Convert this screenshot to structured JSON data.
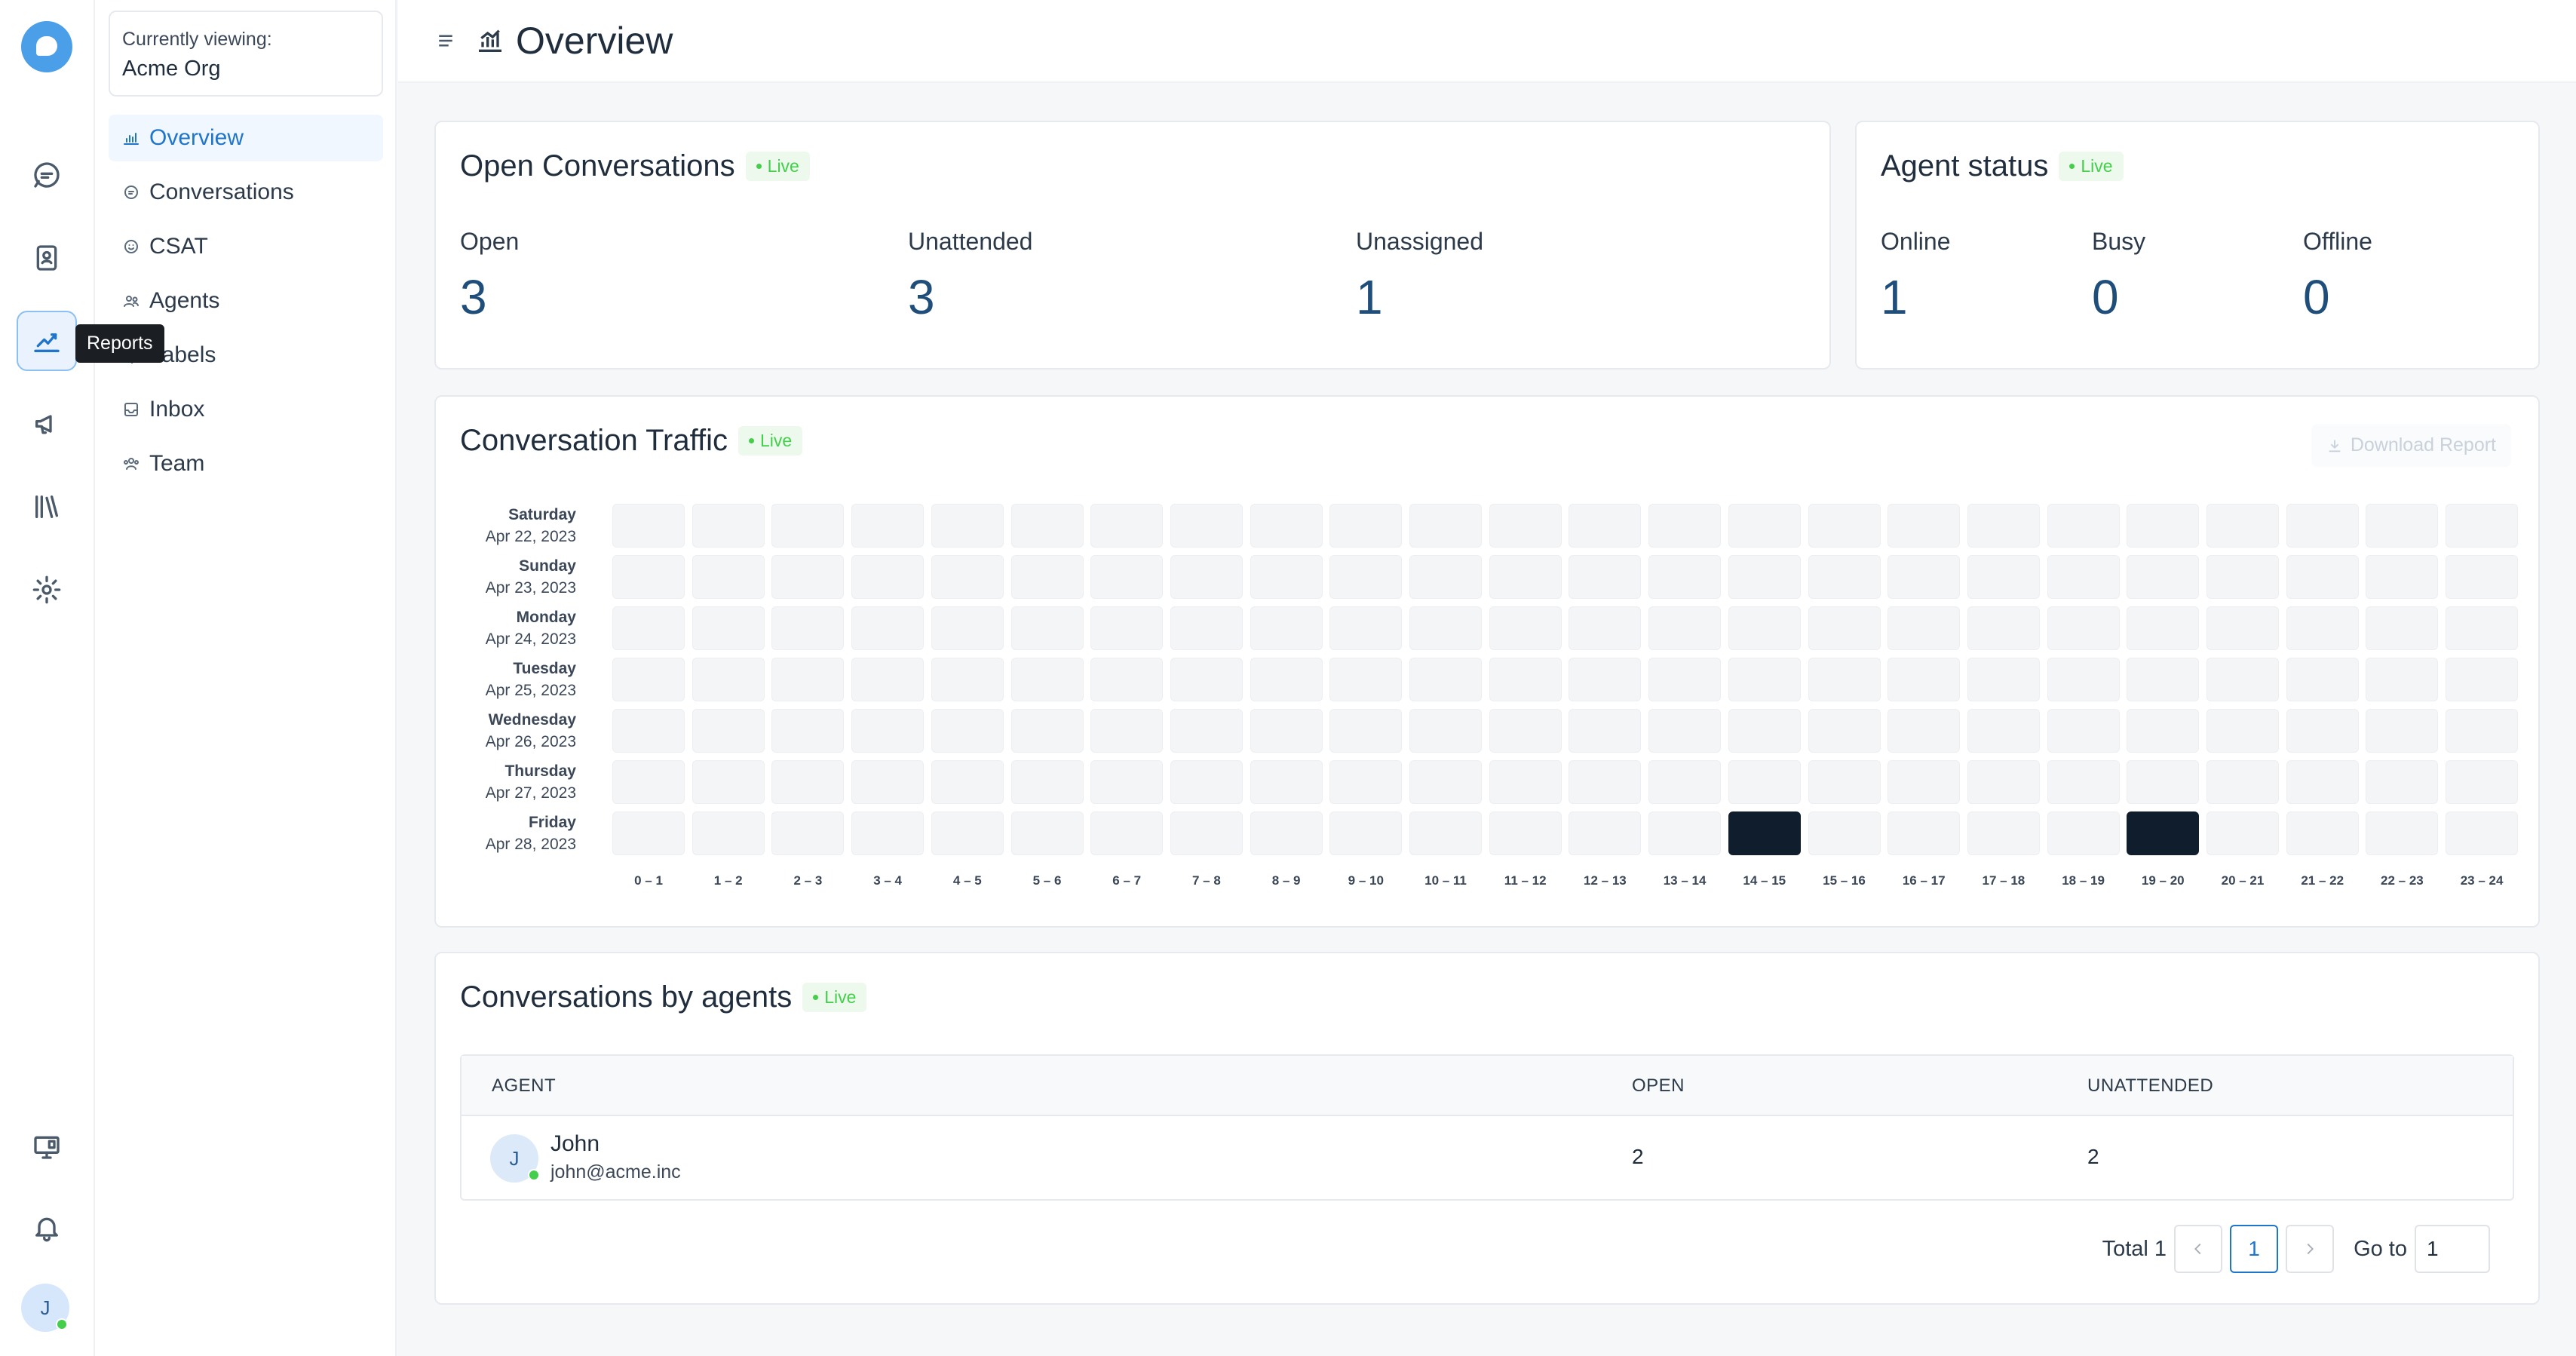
{
  "rail": {
    "tooltip": "Reports",
    "user_initial": "J"
  },
  "sidebar": {
    "org_label": "Currently viewing:",
    "org_name": "Acme Org",
    "items": [
      {
        "label": "Overview"
      },
      {
        "label": "Conversations"
      },
      {
        "label": "CSAT"
      },
      {
        "label": "Agents"
      },
      {
        "label": "Labels"
      },
      {
        "label": "Inbox"
      },
      {
        "label": "Team"
      }
    ]
  },
  "header": {
    "title": "Overview"
  },
  "open_conversations": {
    "title": "Open Conversations",
    "live": "Live",
    "metrics": [
      {
        "label": "Open",
        "value": "3"
      },
      {
        "label": "Unattended",
        "value": "3"
      },
      {
        "label": "Unassigned",
        "value": "1"
      }
    ]
  },
  "agent_status": {
    "title": "Agent status",
    "live": "Live",
    "metrics": [
      {
        "label": "Online",
        "value": "1"
      },
      {
        "label": "Busy",
        "value": "0"
      },
      {
        "label": "Offline",
        "value": "0"
      }
    ]
  },
  "traffic": {
    "title": "Conversation Traffic",
    "live": "Live",
    "download_label": "Download Report",
    "days": [
      {
        "day": "Saturday",
        "date": "Apr 22, 2023"
      },
      {
        "day": "Sunday",
        "date": "Apr 23, 2023"
      },
      {
        "day": "Monday",
        "date": "Apr 24, 2023"
      },
      {
        "day": "Tuesday",
        "date": "Apr 25, 2023"
      },
      {
        "day": "Wednesday",
        "date": "Apr 26, 2023"
      },
      {
        "day": "Thursday",
        "date": "Apr 27, 2023"
      },
      {
        "day": "Friday",
        "date": "Apr 28, 2023"
      }
    ],
    "hours": [
      "0 – 1",
      "1 – 2",
      "2 – 3",
      "3 – 4",
      "4 – 5",
      "5 – 6",
      "6 – 7",
      "7 – 8",
      "8 – 9",
      "9 – 10",
      "10 – 11",
      "11 – 12",
      "12 – 13",
      "13 – 14",
      "14 – 15",
      "15 – 16",
      "16 – 17",
      "17 – 18",
      "18 – 19",
      "19 – 20",
      "20 – 21",
      "21 – 22",
      "22 – 23",
      "23 – 24"
    ],
    "active_cells": [
      {
        "day_index": 6,
        "hour_index": 14
      },
      {
        "day_index": 6,
        "hour_index": 19
      }
    ]
  },
  "agents_table": {
    "title": "Conversations by agents",
    "live": "Live",
    "columns": [
      "AGENT",
      "OPEN",
      "UNATTENDED"
    ],
    "rows": [
      {
        "initial": "J",
        "name": "John",
        "email": "john@acme.inc",
        "open": "2",
        "unattended": "2"
      }
    ],
    "pagination": {
      "total_label": "Total 1",
      "current_page": "1",
      "goto_label": "Go to",
      "goto_value": "1"
    }
  },
  "colors": {
    "accent": "#1f75cb",
    "live_green": "#44ce4b",
    "heat_active": "#0f1d2c"
  }
}
